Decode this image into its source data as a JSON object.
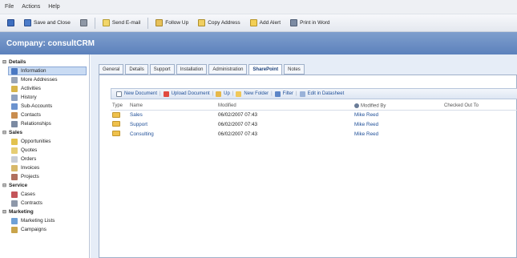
{
  "menu": {
    "file": "File",
    "actions": "Actions",
    "help": "Help"
  },
  "toolbar": {
    "save_close": "Save and Close",
    "send_email": "Send E-mail",
    "follow_up": "Follow Up",
    "copy_address": "Copy Address",
    "add_alert": "Add Alert",
    "print_word": "Print in Word"
  },
  "header": {
    "title": "Company: consultCRM"
  },
  "sidebar": {
    "sections": [
      {
        "label": "Details",
        "items": [
          "Information",
          "More Addresses",
          "Activities",
          "History",
          "Sub-Accounts",
          "Contacts",
          "Relationships"
        ]
      },
      {
        "label": "Sales",
        "items": [
          "Opportunities",
          "Quotes",
          "Orders",
          "Invoices",
          "Projects"
        ]
      },
      {
        "label": "Service",
        "items": [
          "Cases",
          "Contracts"
        ]
      },
      {
        "label": "Marketing",
        "items": [
          "Marketing Lists",
          "Campaigns"
        ]
      }
    ],
    "selected": "Information"
  },
  "tabs": [
    "General",
    "Details",
    "Support",
    "Installation",
    "Administration",
    "SharePoint",
    "Notes"
  ],
  "active_tab": "SharePoint",
  "sp_toolbar": {
    "new_document": "New Document",
    "upload_document": "Upload Document",
    "up": "Up",
    "new_folder": "New Folder",
    "filter": "Filter",
    "edit_datasheet": "Edit in Datasheet"
  },
  "grid": {
    "columns": [
      "Type",
      "Name",
      "Modified",
      "Modified By",
      "Checked Out To"
    ],
    "rows": [
      {
        "name": "Sales",
        "modified": "06/02/2007 07:43",
        "modified_by": "Mike Reed",
        "checked_out": ""
      },
      {
        "name": "Support",
        "modified": "06/02/2007 07:43",
        "modified_by": "Mike Reed",
        "checked_out": ""
      },
      {
        "name": "Consulting",
        "modified": "06/02/2007 07:43",
        "modified_by": "Mike Reed",
        "checked_out": ""
      }
    ]
  }
}
